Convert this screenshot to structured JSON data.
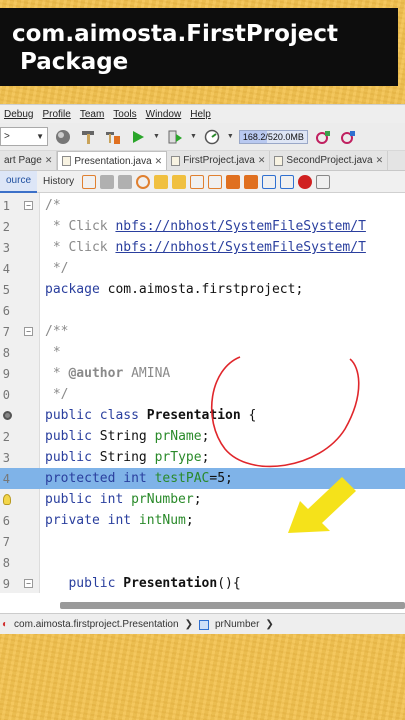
{
  "banner": {
    "line1": "com.aimosta.FirstProject",
    "line2": "Package"
  },
  "menu": [
    "Debug",
    "Profile",
    "Team",
    "Tools",
    "Window",
    "Help"
  ],
  "toolbar": {
    "config_value": ">",
    "memory": "168.2/520.0MB"
  },
  "tabs": [
    {
      "label": "art Page",
      "active": false
    },
    {
      "label": "Presentation.java",
      "active": true
    },
    {
      "label": "FirstProject.java",
      "active": false
    },
    {
      "label": "SecondProject.java",
      "active": false
    }
  ],
  "subtabs": {
    "source": "ource",
    "history": "History"
  },
  "code_lines": [
    {
      "num": "1",
      "parts": [
        [
          "cmt",
          "/*"
        ]
      ]
    },
    {
      "num": "2",
      "parts": [
        [
          "cmt",
          " * Click "
        ],
        [
          "link",
          "nbfs://nbhost/SystemFileSystem/T"
        ]
      ]
    },
    {
      "num": "3",
      "parts": [
        [
          "cmt",
          " * Click "
        ],
        [
          "link",
          "nbfs://nbhost/SystemFileSystem/T"
        ]
      ]
    },
    {
      "num": "4",
      "parts": [
        [
          "cmt",
          " */"
        ]
      ]
    },
    {
      "num": "5",
      "parts": [
        [
          "kw",
          "package "
        ],
        [
          "txt",
          "com.aimosta.firstproject;"
        ]
      ]
    },
    {
      "num": "6",
      "parts": []
    },
    {
      "num": "7",
      "parts": [
        [
          "cmt",
          "/**"
        ]
      ]
    },
    {
      "num": "8",
      "parts": [
        [
          "cmt",
          " *"
        ]
      ]
    },
    {
      "num": "9",
      "parts": [
        [
          "cmt",
          " * "
        ],
        [
          "cmtb",
          "@author"
        ],
        [
          "cmt",
          " AMINA"
        ]
      ]
    },
    {
      "num": "0",
      "parts": [
        [
          "cmt",
          " */"
        ]
      ]
    },
    {
      "num": "",
      "parts": [
        [
          "kw",
          "public class "
        ],
        [
          "bold",
          "Presentation"
        ],
        [
          "txt",
          " {"
        ]
      ]
    },
    {
      "num": "2",
      "parts": [
        [
          "kw",
          "public "
        ],
        [
          "txt",
          "String "
        ],
        [
          "fld",
          "prName"
        ],
        [
          "txt",
          ";"
        ]
      ]
    },
    {
      "num": "3",
      "parts": [
        [
          "kw",
          "public "
        ],
        [
          "txt",
          "String "
        ],
        [
          "fld",
          "prType"
        ],
        [
          "txt",
          ";"
        ]
      ]
    },
    {
      "num": "4",
      "parts": [
        [
          "kw",
          "protected int "
        ],
        [
          "fld",
          "testPAC"
        ],
        [
          "txt",
          "=5;"
        ]
      ]
    },
    {
      "num": "",
      "parts": [
        [
          "kw",
          "public int "
        ],
        [
          "fld",
          "prNumber"
        ],
        [
          "txt",
          ";"
        ]
      ]
    },
    {
      "num": "6",
      "parts": [
        [
          "kw",
          "private int "
        ],
        [
          "fld",
          "intNum"
        ],
        [
          "txt",
          ";"
        ]
      ]
    },
    {
      "num": "7",
      "parts": []
    },
    {
      "num": "8",
      "parts": []
    },
    {
      "num": "9",
      "parts": [
        [
          "txt",
          "   "
        ],
        [
          "kw",
          "public "
        ],
        [
          "bold",
          "Presentation"
        ],
        [
          "txt",
          "(){"
        ]
      ]
    }
  ],
  "statusbar": {
    "path": "com.aimosta.firstproject.Presentation",
    "member": "prNumber"
  },
  "colors": {
    "background": "#f2c14e",
    "highlight": "#7fb3e8",
    "arrow": "#f5e21a",
    "circle": "#e0262b"
  }
}
